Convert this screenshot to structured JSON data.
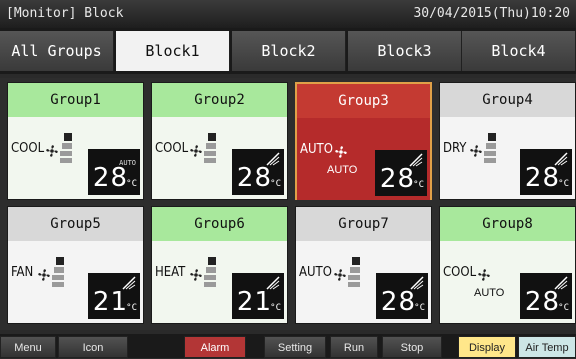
{
  "window": {
    "title": "[Monitor] Block",
    "datetime": "30/04/2015(Thu)10:20"
  },
  "tabs": [
    {
      "label": "All Groups",
      "active": false
    },
    {
      "label": "Block1",
      "active": true
    },
    {
      "label": "Block2",
      "active": false
    },
    {
      "label": "Block3",
      "active": false
    },
    {
      "label": "Block4",
      "active": false
    }
  ],
  "groups": [
    {
      "name": "Group1",
      "mode": "COOL",
      "temp": "28",
      "unit": "°C",
      "state": "on",
      "louver": "auto",
      "fan": "low"
    },
    {
      "name": "Group2",
      "mode": "COOL",
      "temp": "28",
      "unit": "°C",
      "state": "on",
      "louver": "swing",
      "fan": "low"
    },
    {
      "name": "Group3",
      "mode": "AUTO",
      "temp": "28",
      "unit": "°C",
      "state": "alarm",
      "louver": "swing",
      "fan_label": "AUTO"
    },
    {
      "name": "Group4",
      "mode": "DRY",
      "temp": "28",
      "unit": "°C",
      "state": "off",
      "louver": "swing",
      "fan": "low"
    },
    {
      "name": "Group5",
      "mode": "FAN",
      "temp": "21",
      "unit": "°C",
      "state": "off",
      "louver": "swing",
      "fan": "low"
    },
    {
      "name": "Group6",
      "mode": "HEAT",
      "temp": "21",
      "unit": "°C",
      "state": "on",
      "louver": "swing",
      "fan": "low"
    },
    {
      "name": "Group7",
      "mode": "AUTO",
      "temp": "28",
      "unit": "°C",
      "state": "off",
      "louver": "swing",
      "fan": "low"
    },
    {
      "name": "Group8",
      "mode": "COOL",
      "temp": "28",
      "unit": "°C",
      "state": "on",
      "louver": "swing",
      "fan_label": "AUTO"
    }
  ],
  "louver_auto_label": "AUTO",
  "bottom": {
    "menu": "Menu",
    "icon": "Icon",
    "alarm": "Alarm",
    "setting": "Setting",
    "run": "Run",
    "stop": "Stop",
    "display": "Display",
    "air_temp": "Air Temp"
  },
  "colors": {
    "on": "#a8e89c",
    "off": "#d8d8d8",
    "alarm": "#b52b2b"
  }
}
